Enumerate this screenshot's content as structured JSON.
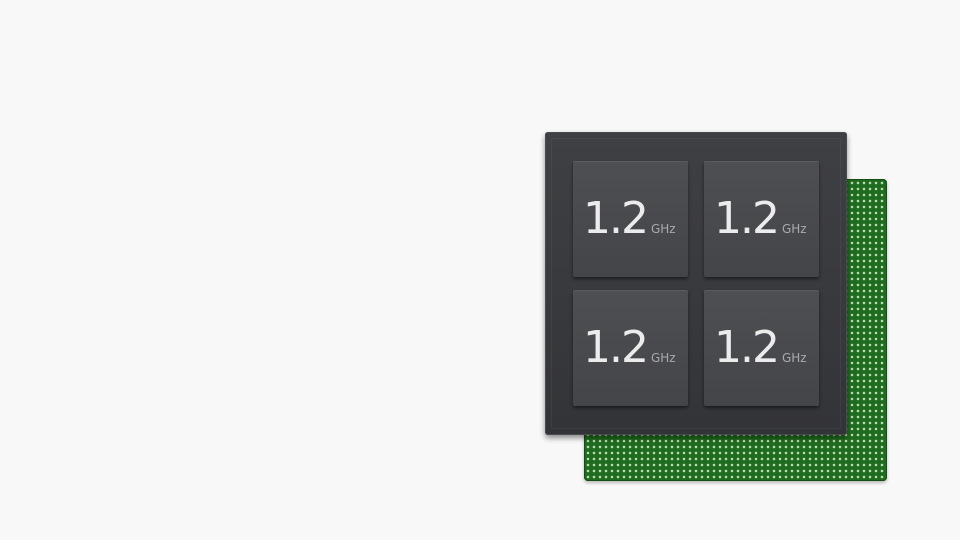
{
  "processor": {
    "cores": [
      {
        "value": "1.2",
        "unit": "GHz"
      },
      {
        "value": "1.2",
        "unit": "GHz"
      },
      {
        "value": "1.2",
        "unit": "GHz"
      },
      {
        "value": "1.2",
        "unit": "GHz"
      }
    ]
  },
  "colors": {
    "background": "#f8f8f8",
    "chip": "#3a3b3e",
    "core": "#4a4b4e",
    "pcb": "#1f6b1f",
    "pcb_dots": "#b9d9b0",
    "text": "#ececec",
    "unit_text": "#a9aaac"
  }
}
